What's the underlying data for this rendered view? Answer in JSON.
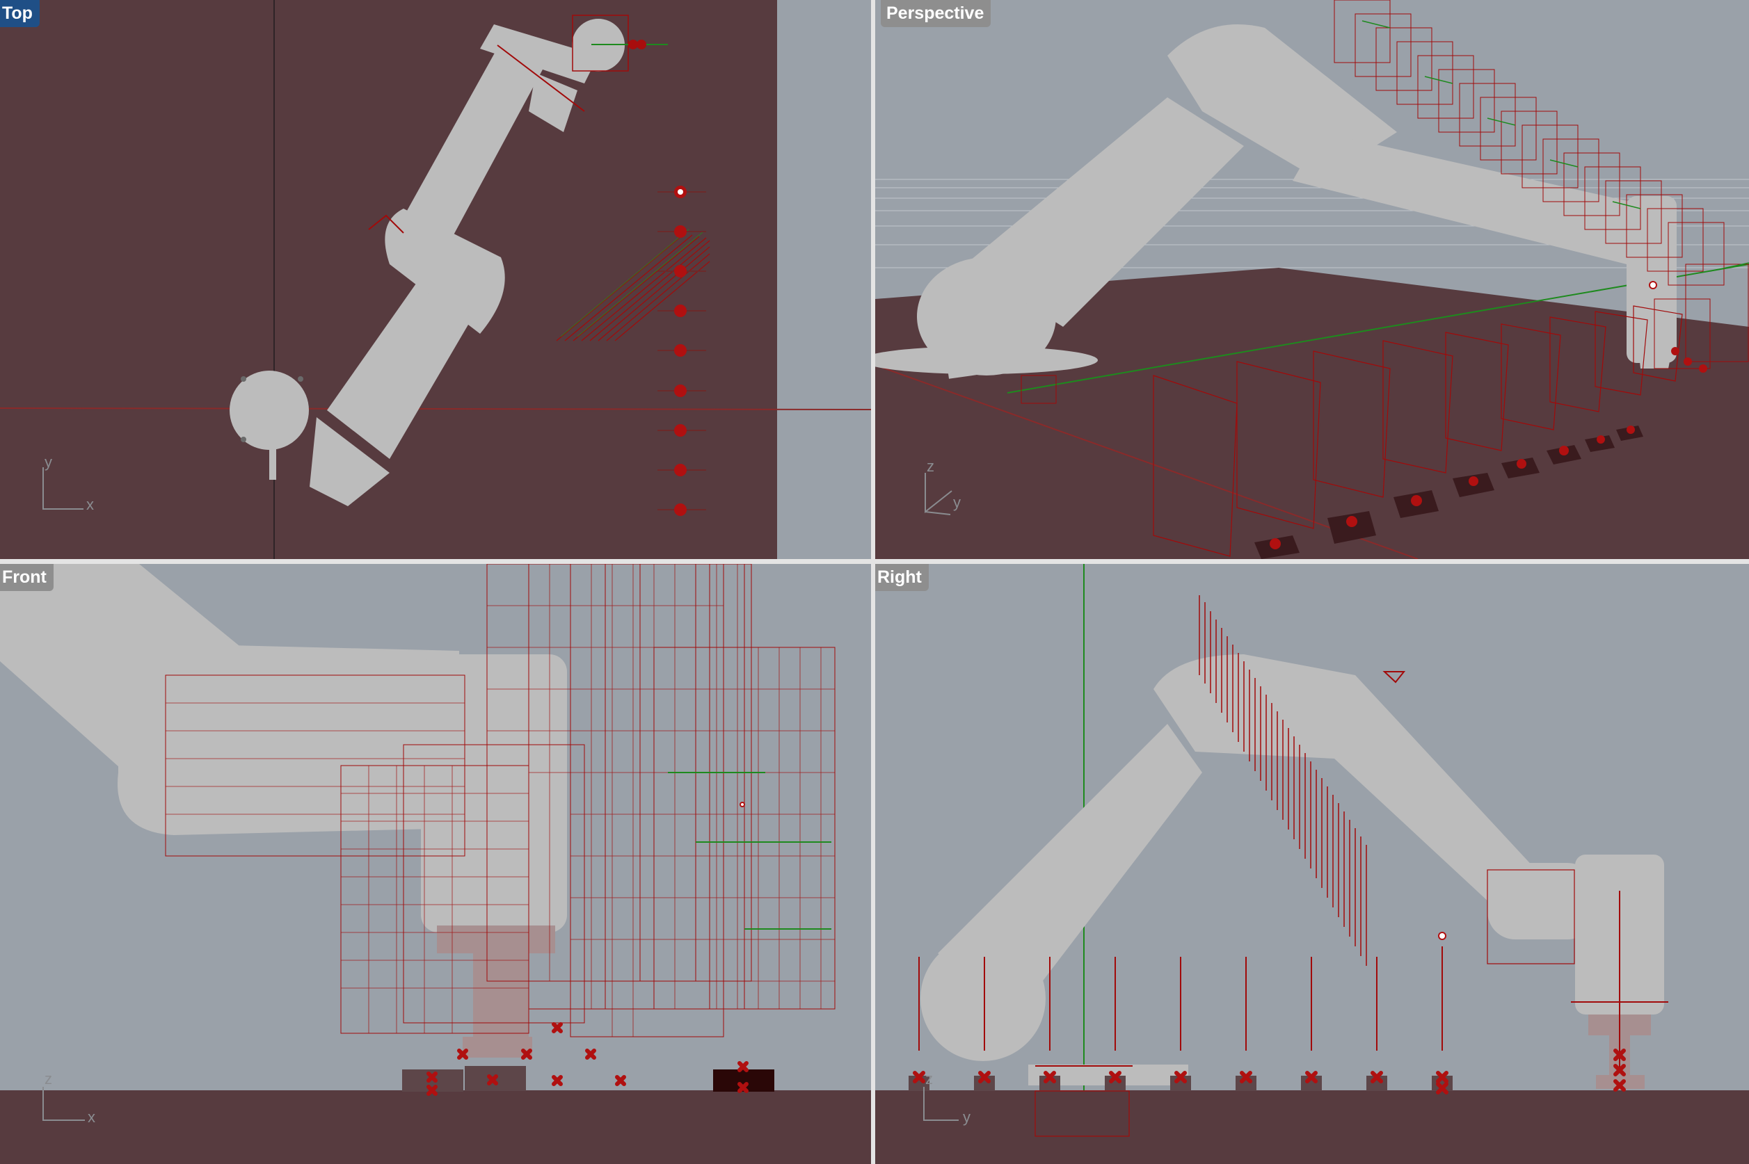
{
  "viewports": {
    "top": {
      "label": "Top",
      "active": true,
      "axis_labels": [
        "y",
        "x"
      ]
    },
    "perspective": {
      "label": "Perspective",
      "active": false,
      "axis_labels": [
        "z",
        "y"
      ]
    },
    "front": {
      "label": "Front",
      "active": false,
      "axis_labels": [
        "z",
        "x"
      ]
    },
    "right": {
      "label": "Right",
      "active": false,
      "axis_labels": [
        "z",
        "y"
      ]
    }
  },
  "colors": {
    "background": "#9aa1a9",
    "ground_plane": "#573b3f",
    "robot": "#bcbcbc",
    "selection_red": "#a10a0a",
    "target_marker": "#a80d0d",
    "y_axis_green": "#1e8a1e",
    "x_axis_red": "#b01010",
    "active_label": "#1f4f86",
    "inactive_label": "#8e8e8e"
  }
}
